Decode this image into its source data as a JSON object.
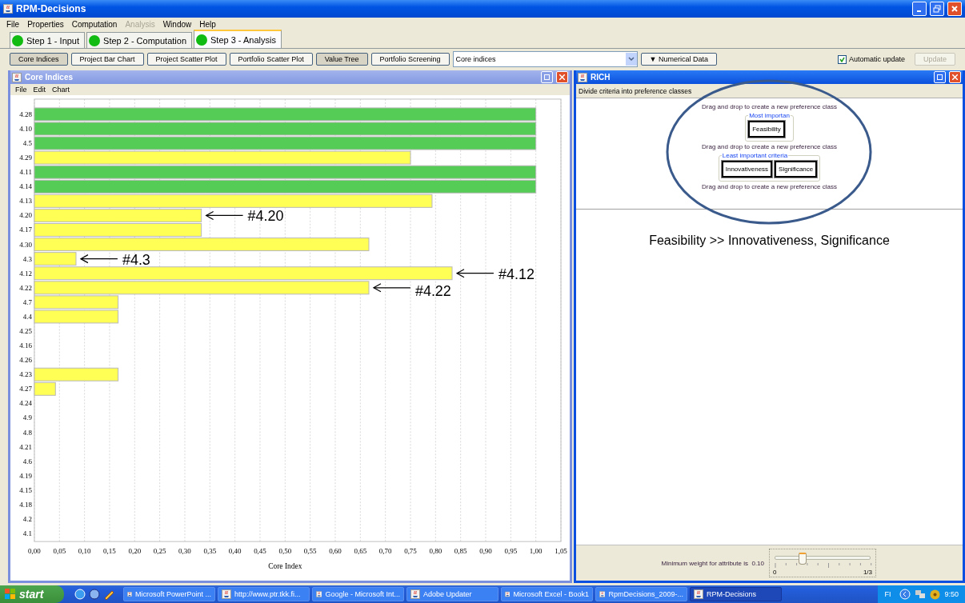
{
  "window": {
    "title": "RPM-Decisions"
  },
  "menu": [
    {
      "label": "File",
      "disabled": false
    },
    {
      "label": "Properties",
      "disabled": false
    },
    {
      "label": "Computation",
      "disabled": false
    },
    {
      "label": "Analysis",
      "disabled": true
    },
    {
      "label": "Window",
      "disabled": false
    },
    {
      "label": "Help",
      "disabled": false
    }
  ],
  "steps": [
    {
      "label": "Step 1 - Input",
      "selected": false
    },
    {
      "label": "Step 2 - Computation",
      "selected": false
    },
    {
      "label": "Step 3 - Analysis",
      "selected": true
    }
  ],
  "toolbar": {
    "views": [
      {
        "label": "Core Indices",
        "selected": true
      },
      {
        "label": "Project Bar Chart",
        "selected": false
      },
      {
        "label": "Project Scatter Plot",
        "selected": false
      },
      {
        "label": "Portfolio Scatter Plot",
        "selected": false
      },
      {
        "label": "Value Tree",
        "selected": true
      },
      {
        "label": "Portfolio Screening",
        "selected": false
      }
    ],
    "view_select": {
      "value": "Core indices"
    },
    "numerical_data": "▼ Numerical Data",
    "automatic_update": {
      "label": "Automatic update",
      "checked": true
    },
    "update": {
      "label": "Update",
      "disabled": true
    }
  },
  "core_indices_frame": {
    "title": "Core Indices",
    "menu": [
      "File",
      "Edit",
      "Chart"
    ],
    "chart_data": {
      "type": "bar",
      "orientation": "horizontal",
      "xlabel": "Core Index",
      "xlim": [
        0,
        1.05
      ],
      "categories": [
        "4.28",
        "4.10",
        "4.5",
        "4.29",
        "4.11",
        "4.14",
        "4.13",
        "4.20",
        "4.17",
        "4.30",
        "4.3",
        "4.12",
        "4.22",
        "4.7",
        "4.4",
        "4.25",
        "4.16",
        "4.26",
        "4.23",
        "4.27",
        "4.24",
        "4.9",
        "4.8",
        "4.21",
        "4.6",
        "4.19",
        "4.15",
        "4.18",
        "4.2",
        "4.1"
      ],
      "grid": true,
      "values": [
        1,
        1,
        1,
        0.75,
        1,
        1,
        0.793,
        0.333,
        0.333,
        0.667,
        0.083,
        0.833,
        0.667,
        0.167,
        0.167,
        null,
        null,
        null,
        0.167,
        0.042,
        null,
        null,
        null,
        null,
        null,
        null,
        null,
        null,
        null,
        null
      ],
      "xticks": [
        {
          "value": 0,
          "label": "0,00"
        },
        {
          "value": 0.05,
          "label": "0,05"
        },
        {
          "value": 0.1,
          "label": "0,10"
        },
        {
          "value": 0.15,
          "label": "0,15"
        },
        {
          "value": 0.2,
          "label": "0,20"
        },
        {
          "value": 0.25,
          "label": "0,25"
        },
        {
          "value": 0.3,
          "label": "0,30"
        },
        {
          "value": 0.35,
          "label": "0,35"
        },
        {
          "value": 0.4,
          "label": "0,40"
        },
        {
          "value": 0.45,
          "label": "0,45"
        },
        {
          "value": 0.5,
          "label": "0,50"
        },
        {
          "value": 0.55,
          "label": "0,55"
        },
        {
          "value": 0.6,
          "label": "0,60"
        },
        {
          "value": 0.65,
          "label": "0,65"
        },
        {
          "value": 0.7,
          "label": "0,70"
        },
        {
          "value": 0.75,
          "label": "0,75"
        },
        {
          "value": 0.8,
          "label": "0,80"
        },
        {
          "value": 0.85,
          "label": "0,85"
        },
        {
          "value": 0.9,
          "label": "0,90"
        },
        {
          "value": 0.95,
          "label": "0,95"
        },
        {
          "value": 1,
          "label": "1,00"
        },
        {
          "value": 1.05,
          "label": "1,05"
        }
      ],
      "annotations": [
        {
          "text": "#4.20",
          "x": 0.333,
          "y": "4.20"
        },
        {
          "text": "#4.3",
          "x": 0.083,
          "y": "4.3"
        },
        {
          "text": "#4.12",
          "x": 0.833,
          "y": "4.12"
        },
        {
          "text": "#4.22",
          "x": 0.667,
          "y": "4.22"
        }
      ]
    }
  },
  "rich_frame": {
    "title": "RICH",
    "instruction": "Divide criteria into preference classes",
    "drop_hints": [
      "Drag and drop to create a new preference class",
      "Drag and drop to create a new preference class",
      "Drag and drop to create a new preference class"
    ],
    "classes": [
      {
        "title": "Most importan",
        "criteria": [
          "Feasibility"
        ]
      },
      {
        "title": "Least important criteria",
        "criteria": [
          "Innovativeness",
          "Significance"
        ]
      }
    ],
    "summary": "Feasibility >> Innovativeness, Significance",
    "slider": {
      "label": "Minimum weight for attribute is  0.10",
      "level": 0.28,
      "min_label": "0",
      "max_label": "1/3"
    }
  },
  "taskbar": {
    "start": "start",
    "tasks": [
      {
        "label": "Microsoft PowerPoint ...",
        "selected": false
      },
      {
        "label": "http://www.ptr.tkk.fi...",
        "selected": false
      },
      {
        "label": "Google - Microsoft Int...",
        "selected": false
      },
      {
        "label": "Adobe Updater",
        "selected": false
      },
      {
        "label": "Microsoft Excel - Book1",
        "selected": false
      },
      {
        "label": "RpmDecisions_2009-...",
        "selected": false
      },
      {
        "label": "RPM-Decisions",
        "selected": true
      }
    ],
    "language": "FI",
    "clock": "9:50"
  }
}
